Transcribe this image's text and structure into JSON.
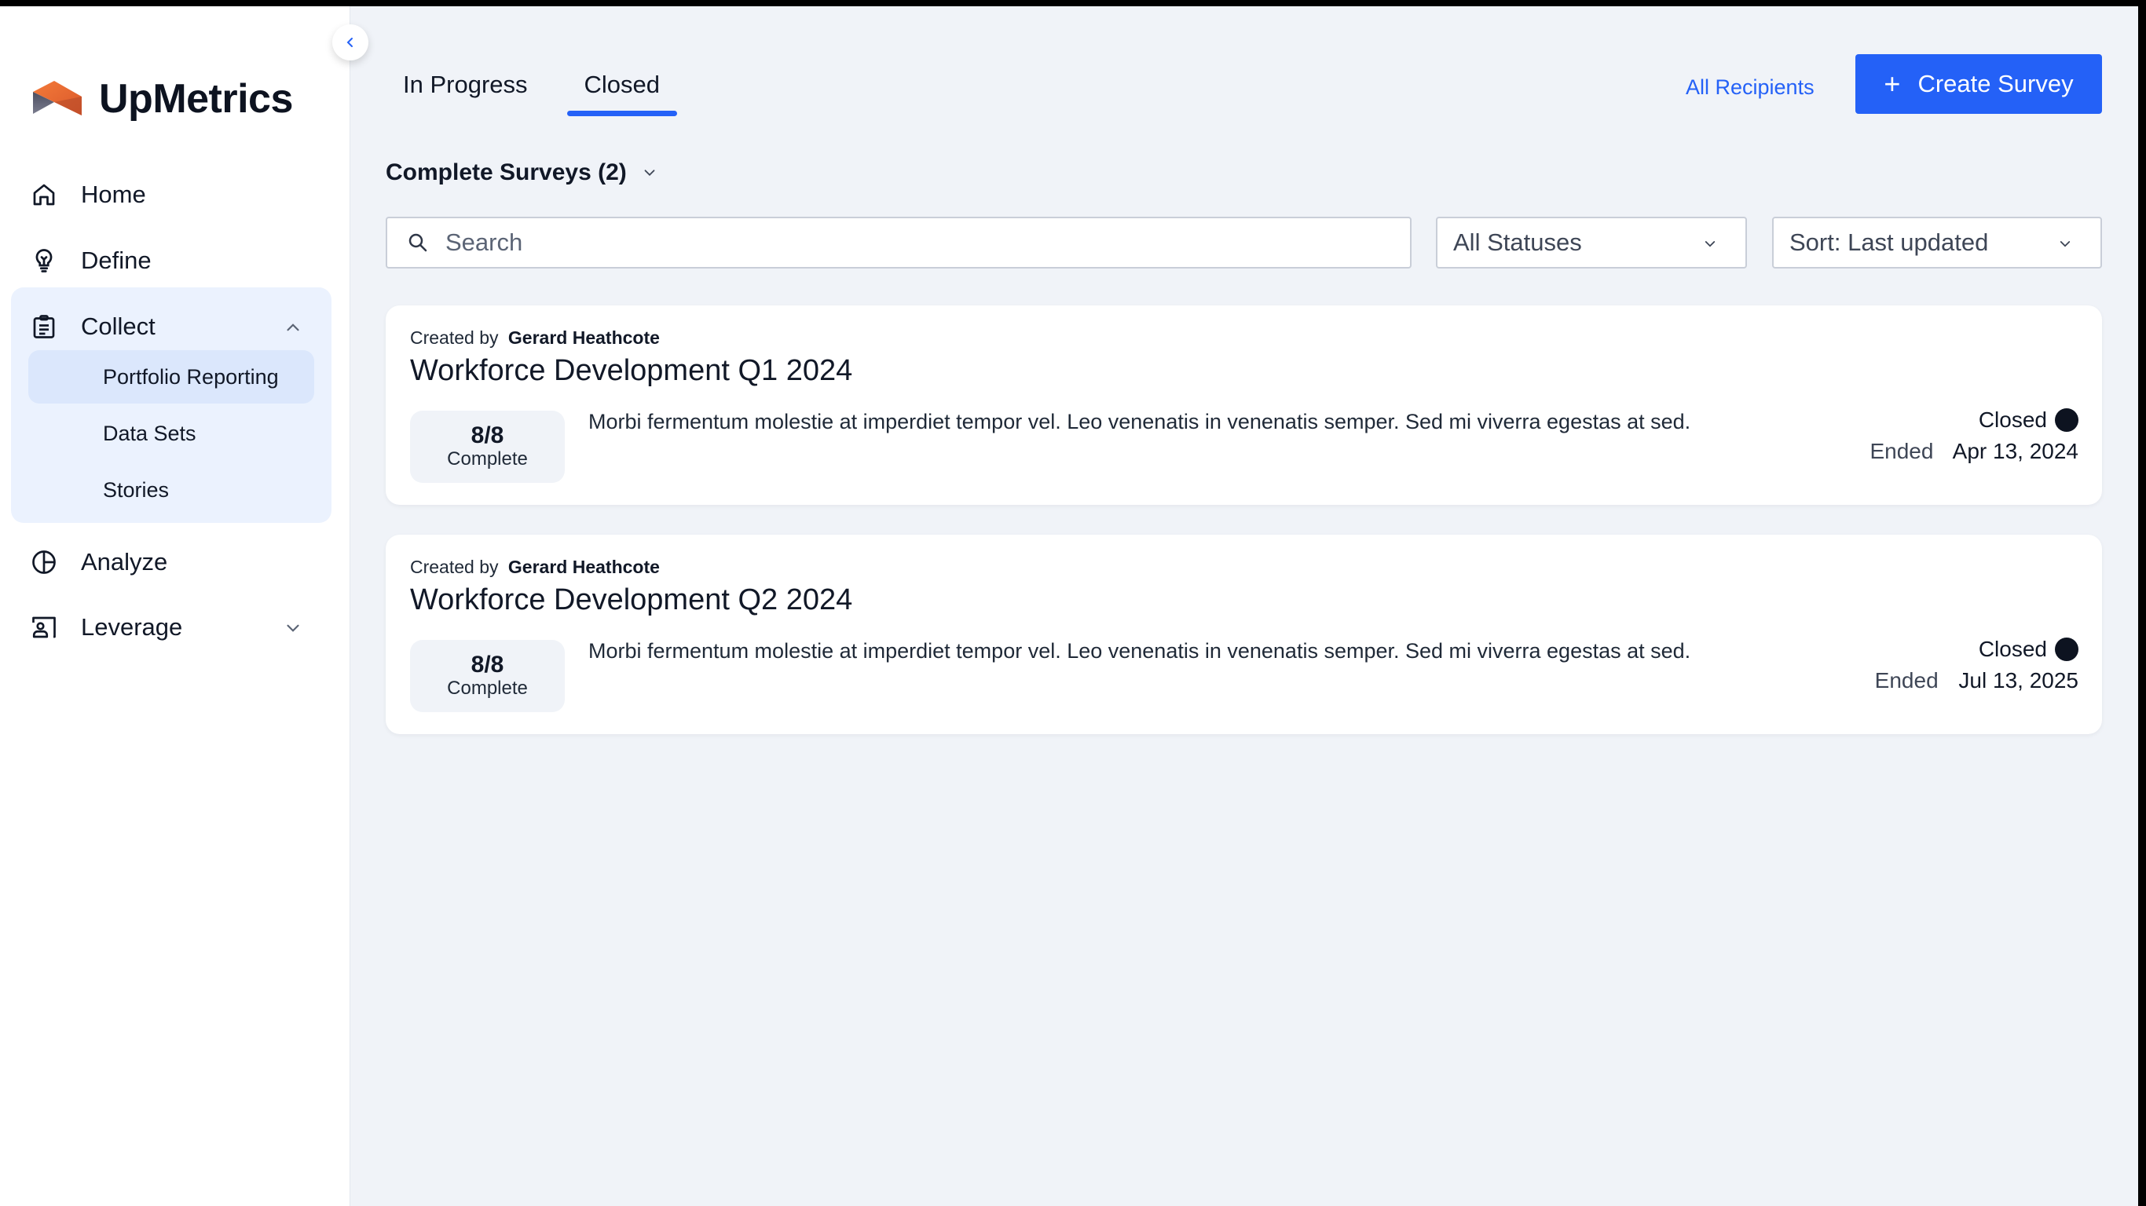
{
  "brand": {
    "name": "UpMetrics",
    "logo_colors": {
      "orange": "#EE6A2E",
      "slate": "#5E6072"
    }
  },
  "colors": {
    "accent": "#2461F7",
    "sidebar_group_bg": "#EBF2FE",
    "sidebar_active_bg": "#DBE7FC",
    "page_bg": "#F0F3F8",
    "status_closed": "#0D1320"
  },
  "sidebar": {
    "collapse_icon": "chevron-left-icon",
    "items": [
      {
        "label": "Home",
        "icon": "home-icon"
      },
      {
        "label": "Define",
        "icon": "lightbulb-icon"
      },
      {
        "label": "Collect",
        "icon": "clipboard-icon",
        "expanded": true,
        "children": [
          {
            "label": "Portfolio Reporting",
            "active": true
          },
          {
            "label": "Data Sets"
          },
          {
            "label": "Stories"
          }
        ]
      },
      {
        "label": "Analyze",
        "icon": "pie-chart-icon"
      },
      {
        "label": "Leverage",
        "icon": "user-card-icon",
        "expanded": false
      }
    ]
  },
  "header": {
    "tabs": [
      {
        "label": "In Progress",
        "active": false
      },
      {
        "label": "Closed",
        "active": true
      }
    ],
    "all_recipients_label": "All Recipients",
    "create_survey_label": "Create Survey",
    "create_survey_icon": "plus-icon"
  },
  "section": {
    "title": "Complete Surveys (2)"
  },
  "filters": {
    "search_placeholder": "Search",
    "search_value": "",
    "status_selected": "All Statuses",
    "sort_selected": "Sort: Last updated"
  },
  "surveys": [
    {
      "created_by_label": "Created by",
      "creator": "Gerard Heathcote",
      "title": "Workforce Development Q1 2024",
      "progress_count": "8/8",
      "progress_label": "Complete",
      "description": "Morbi fermentum molestie at imperdiet tempor vel. Leo venenatis in venenatis semper. Sed mi viverra egestas at sed.",
      "status": "Closed",
      "ended_label": "Ended",
      "ended_date": "Apr 13, 2024"
    },
    {
      "created_by_label": "Created by",
      "creator": "Gerard Heathcote",
      "title": "Workforce Development Q2 2024",
      "progress_count": "8/8",
      "progress_label": "Complete",
      "description": "Morbi fermentum molestie at imperdiet tempor vel. Leo venenatis in venenatis semper. Sed mi viverra egestas at sed.",
      "status": "Closed",
      "ended_label": "Ended",
      "ended_date": "Jul 13, 2025"
    }
  ]
}
